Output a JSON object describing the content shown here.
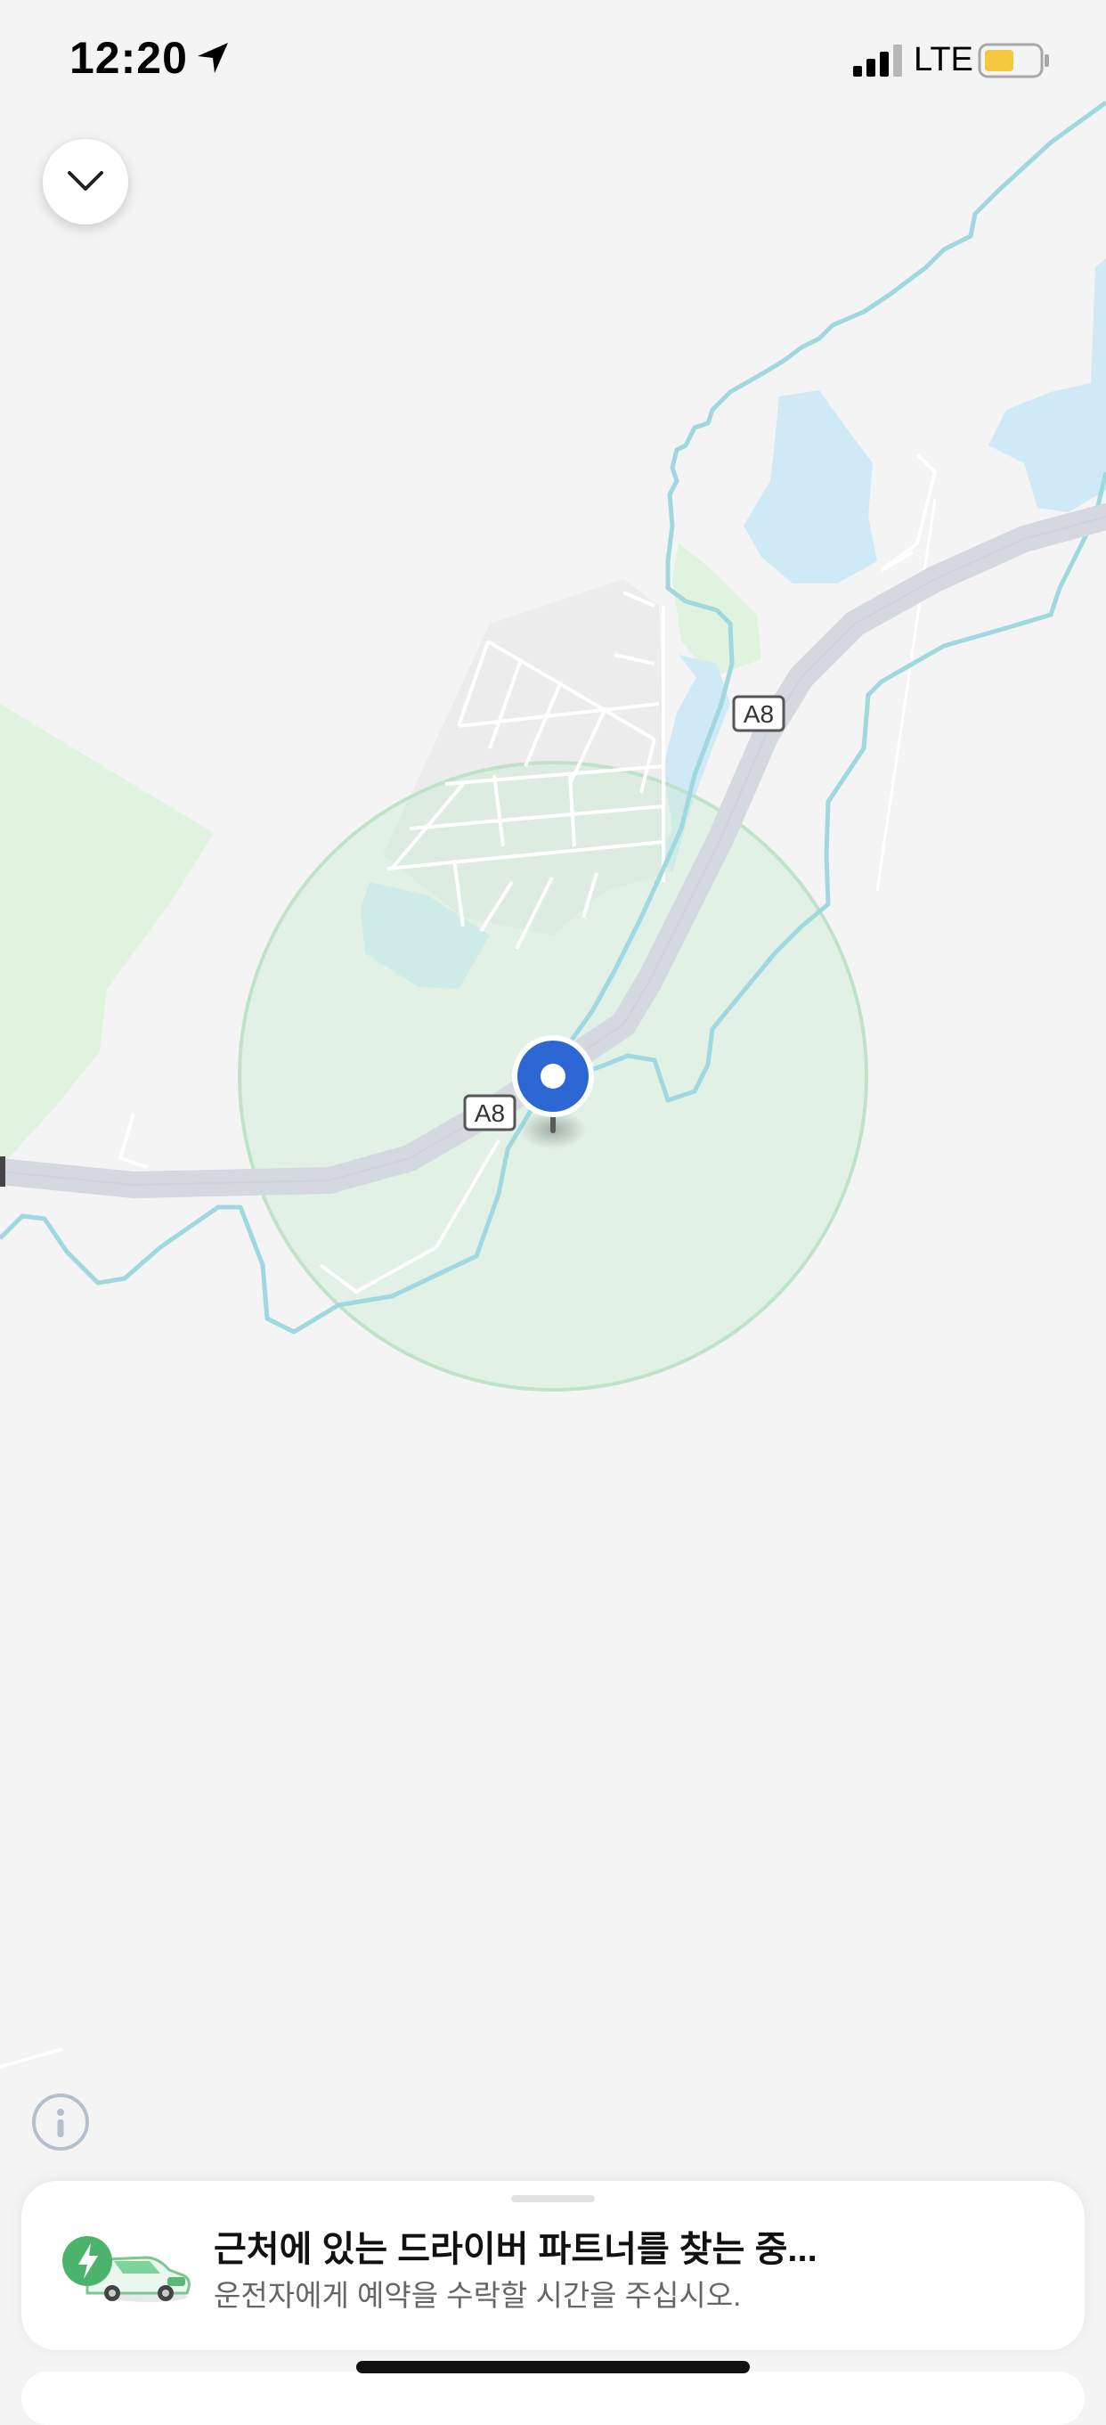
{
  "status_bar": {
    "time": "12:20",
    "network": "LTE",
    "battery_color": "#f5c842"
  },
  "map": {
    "road_shields": [
      "A8",
      "A8"
    ],
    "colors": {
      "background": "#f4f4f4",
      "road": "#d5d8de",
      "water": "#cfe9f7",
      "river": "#9fd8df",
      "park": "#dff3df",
      "search_radius": "#cdeed5",
      "pin": "#2d67d4"
    }
  },
  "buttons": {
    "collapse_icon": "chevron-down-icon",
    "info_icon": "info-icon"
  },
  "bottom_sheet": {
    "title": "근처에 있는 드라이버 파트너를 찾는 중...",
    "subtitle": "운전자에게 예약을 수락할 시간을 주십시오.",
    "icon": "green-car-lightning-icon"
  }
}
